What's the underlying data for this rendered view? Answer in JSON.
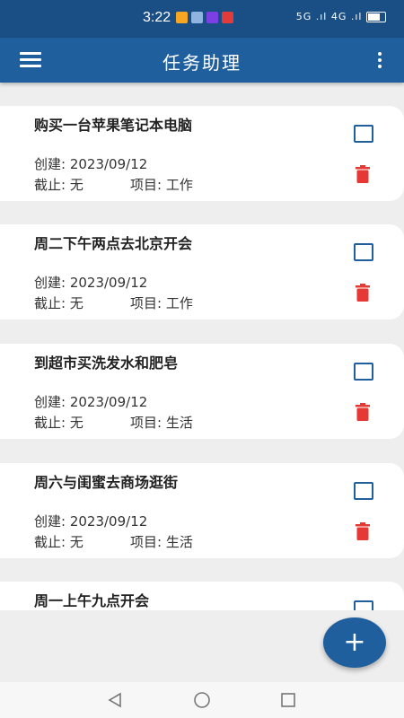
{
  "status_bar": {
    "time": "3:22",
    "right_text": "5G .ıl 4G .ıl"
  },
  "app_bar": {
    "title": "任务助理",
    "menu_icon": "hamburger-menu-icon",
    "more_icon": "more-vert-icon"
  },
  "tasks": [
    {
      "title": "购买一台苹果笔记本电脑",
      "created": "创建: 2023/09/12",
      "due": "截止: 无",
      "project": "项目: 工作"
    },
    {
      "title": "周二下午两点去北京开会",
      "created": "创建: 2023/09/12",
      "due": "截止: 无",
      "project": "项目: 工作"
    },
    {
      "title": "到超市买洗发水和肥皂",
      "created": "创建: 2023/09/12",
      "due": "截止: 无",
      "project": "项目: 生活"
    },
    {
      "title": "周六与闺蜜去商场逛街",
      "created": "创建: 2023/09/12",
      "due": "截止: 无",
      "project": "项目: 生活"
    },
    {
      "title": "周一上午九点开会",
      "created": "",
      "due": "",
      "project": ""
    }
  ],
  "fab": {
    "label": "+",
    "icon": "add-icon"
  },
  "colors": {
    "primary": "#1f5f9e",
    "status_bar": "#1a4f86",
    "delete": "#e53935",
    "background": "#eeeeee"
  },
  "nav": {
    "back_icon": "back-triangle-icon",
    "home_icon": "home-circle-icon",
    "recents_icon": "recents-square-icon"
  }
}
